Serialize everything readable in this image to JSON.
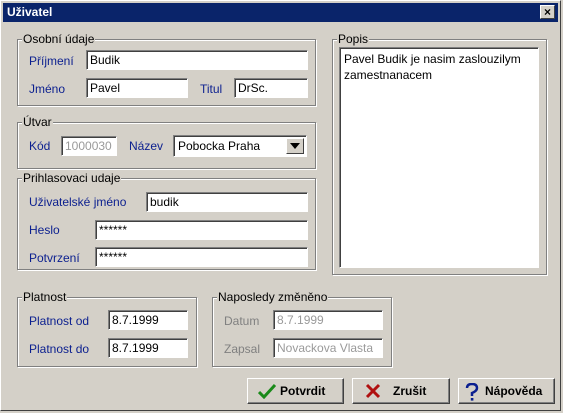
{
  "window": {
    "title": "Uživatel",
    "close_glyph": "×"
  },
  "personal": {
    "legend": "Osobní údaje",
    "surname_label": "Příjmení",
    "surname_value": "Budik",
    "firstname_label": "Jméno",
    "firstname_value": "Pavel",
    "title_label": "Titul",
    "title_value": "DrSc."
  },
  "unit": {
    "legend": "Útvar",
    "code_label": "Kód",
    "code_value": "1000030",
    "name_label": "Název",
    "name_value": "Pobocka Praha"
  },
  "login": {
    "legend": "Prihlasovaci udaje",
    "username_label": "Uživatelské jméno",
    "username_value": "budik",
    "password_label": "Heslo",
    "password_value": "******",
    "confirm_label": "Potvrzení",
    "confirm_value": "******"
  },
  "note": {
    "legend": "Popis",
    "text": "Pavel Budik je nasim zaslouzilym zamestnanacem"
  },
  "validity": {
    "legend": "Platnost",
    "from_label": "Platnost od",
    "from_value": "8.7.1999",
    "to_label": "Platnost do",
    "to_value": "8.7.1999"
  },
  "changed": {
    "legend": "Naposledy změněno",
    "date_label": "Datum",
    "date_value": "8.7.1999",
    "by_label": "Zapsal",
    "by_value": "Novackova Vlasta"
  },
  "buttons": {
    "confirm_label": "Potvrdit",
    "cancel_label": "Zrušit",
    "help_label": "Nápověda"
  },
  "icons": {
    "confirm": "check-icon",
    "cancel": "x-icon",
    "help": "question-icon",
    "dropdown": "chevron-down-icon"
  },
  "colors": {
    "titlebar": "#0a246a",
    "label_text": "#0b1f8f",
    "face": "#d4d0c8"
  }
}
